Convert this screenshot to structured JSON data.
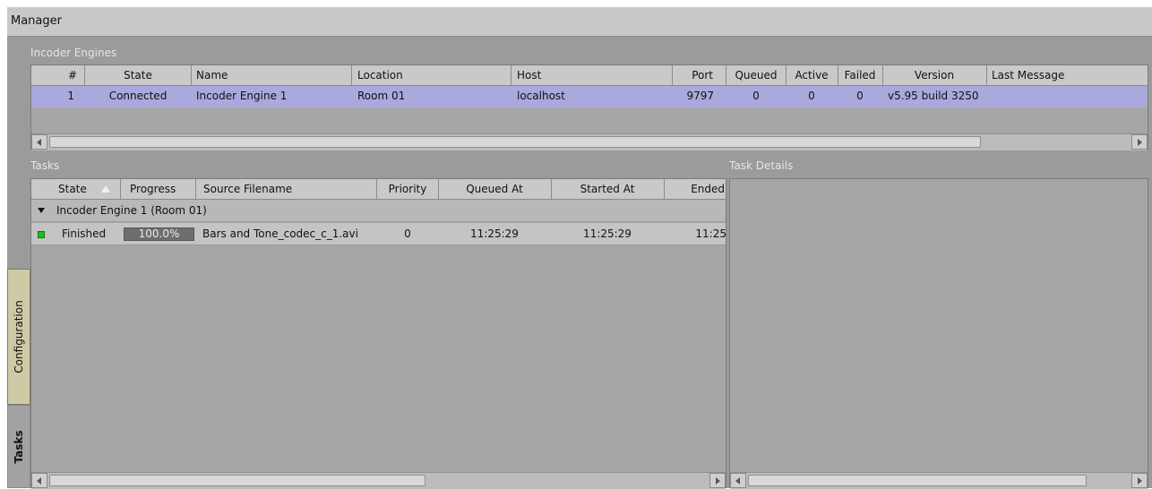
{
  "window": {
    "title": "Manager"
  },
  "engines": {
    "label": "Incoder Engines",
    "columns": [
      "#",
      "State",
      "Name",
      "Location",
      "Host",
      "Port",
      "Queued",
      "Active",
      "Failed",
      "Version",
      "Last Message"
    ],
    "rows": [
      {
        "num": "1",
        "state": "Connected",
        "name": "Incoder Engine 1",
        "location": "Room 01",
        "host": "localhost",
        "port": "9797",
        "queued": "0",
        "active": "0",
        "failed": "0",
        "version": "v5.95 build 3250",
        "last_message": ""
      }
    ]
  },
  "tasks": {
    "label": "Tasks",
    "columns": [
      "State",
      "Progress",
      "Source Filename",
      "Priority",
      "Queued At",
      "Started At",
      "Ended"
    ],
    "sort_icon": "sort-ascending-icon",
    "group": {
      "label": "Incoder Engine 1 (Room 01)",
      "icon": "expand-triangle-icon"
    },
    "rows": [
      {
        "state": "Finished",
        "status_color": "#17c21a",
        "progress": 1.0,
        "progress_label": "100.0%",
        "filename": "Bars and Tone_codec_c_1.avi",
        "priority": "0",
        "queued_at": "11:25:29",
        "started_at": "11:25:29",
        "ended": "11:25"
      }
    ]
  },
  "details": {
    "label": "Task Details"
  },
  "side_tabs": [
    {
      "label": "Configuration",
      "active": false
    },
    {
      "label": "Tasks",
      "active": true
    }
  ],
  "colors": {
    "selected_row": "#aaa9dd",
    "panel": "#9b9b9b",
    "header": "#c9c9c9",
    "tab": "#cfc9a6"
  }
}
